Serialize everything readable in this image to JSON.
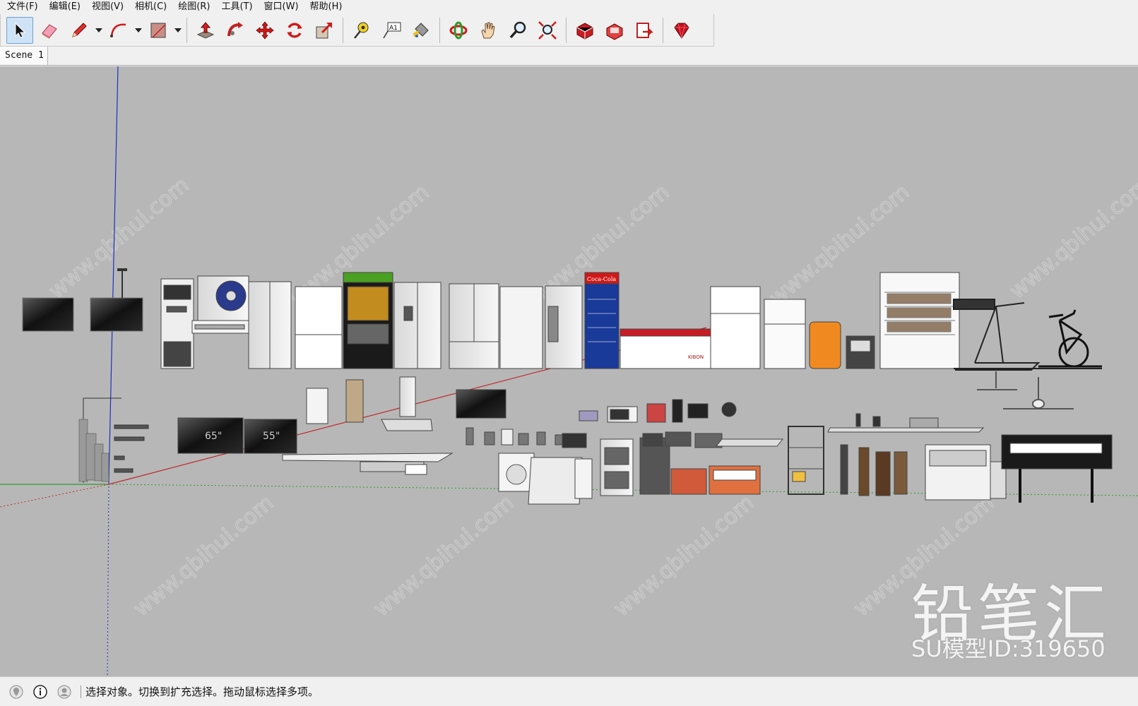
{
  "menubar": {
    "items": [
      "文件(F)",
      "编辑(E)",
      "视图(V)",
      "相机(C)",
      "绘图(R)",
      "工具(T)",
      "窗口(W)",
      "帮助(H)"
    ]
  },
  "toolbar": {
    "tools": [
      {
        "name": "select-tool",
        "icon": "arrow-cursor-icon",
        "active": true
      },
      {
        "name": "eraser-tool",
        "icon": "eraser-icon"
      },
      {
        "name": "pencil-tool",
        "icon": "pencil-icon",
        "dropdown": true
      },
      {
        "name": "arc-tool",
        "icon": "arc-icon",
        "dropdown": true
      },
      {
        "name": "shape-tool",
        "icon": "rectangle-icon",
        "dropdown": true
      },
      {
        "name": "push-pull-tool",
        "icon": "push-pull-icon"
      },
      {
        "name": "follow-me-tool",
        "icon": "follow-me-icon"
      },
      {
        "name": "move-tool",
        "icon": "move-icon"
      },
      {
        "name": "rotate-tool",
        "icon": "rotate-icon"
      },
      {
        "name": "scale-tool",
        "icon": "scale-icon"
      },
      {
        "name": "tape-measure-tool",
        "icon": "tape-measure-icon"
      },
      {
        "name": "text-tool",
        "icon": "text-label-icon",
        "label": "A1"
      },
      {
        "name": "paint-bucket-tool",
        "icon": "paint-bucket-icon"
      },
      {
        "name": "orbit-tool",
        "icon": "orbit-icon"
      },
      {
        "name": "pan-tool",
        "icon": "hand-icon"
      },
      {
        "name": "zoom-tool",
        "icon": "magnifier-icon"
      },
      {
        "name": "zoom-extents-tool",
        "icon": "zoom-extents-icon"
      },
      {
        "name": "warehouse-tool",
        "icon": "3d-warehouse-icon"
      },
      {
        "name": "extension-warehouse-tool",
        "icon": "extension-warehouse-icon"
      },
      {
        "name": "send-to-layout-tool",
        "icon": "layout-icon"
      },
      {
        "name": "extension-manager-tool",
        "icon": "ruby-gem-icon"
      }
    ]
  },
  "scene": {
    "tab_label": "Scene 1"
  },
  "viewport": {
    "background": "#b7b7b7",
    "axis_colors": {
      "red": "#c0282a",
      "green": "#2d9a2d",
      "blue": "#2030c0"
    },
    "watermark": {
      "title": "铅笔汇",
      "model_id": "SU模型ID:319650",
      "url": "www.qbihui.com"
    },
    "labels": {
      "tv_size_a": "65\"",
      "tv_size_b": "55\"",
      "fridge_brand": "Coca-Cola",
      "freezer_brand": "KIBON"
    }
  },
  "statusbar": {
    "icons": [
      "geo-location-icon",
      "info-icon",
      "user-account-icon"
    ],
    "text": "选择对象。切换到扩充选择。拖动鼠标选择多项。"
  }
}
